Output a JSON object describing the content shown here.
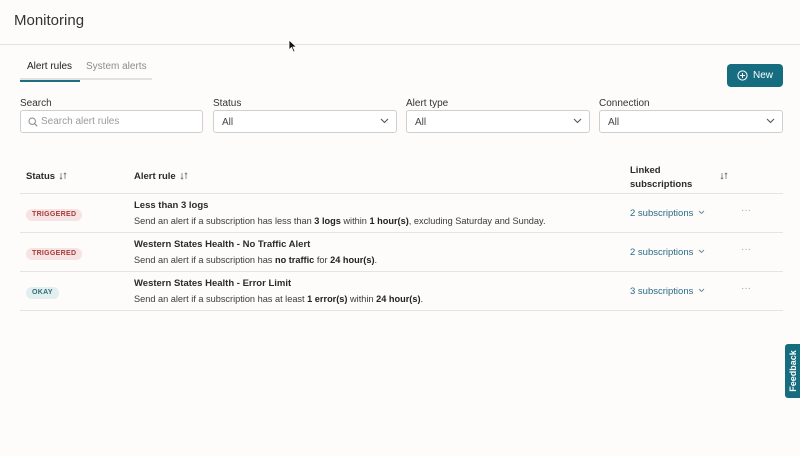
{
  "app": {
    "title": "Monitoring"
  },
  "tabs": [
    {
      "label": "Alert rules",
      "active": true
    },
    {
      "label": "System alerts",
      "active": false
    }
  ],
  "new_button": {
    "label": "New",
    "icon": "plus-circle-icon"
  },
  "filters": {
    "search": {
      "label": "Search",
      "placeholder": "Search alert rules",
      "value": ""
    },
    "status": {
      "label": "Status",
      "value": "All"
    },
    "alert_type": {
      "label": "Alert type",
      "value": "All"
    },
    "connection": {
      "label": "Connection",
      "value": "All"
    }
  },
  "table": {
    "columns": {
      "status": "Status",
      "alert_rule": "Alert rule",
      "linked_line1": "Linked",
      "linked_line2": "subscriptions"
    },
    "rows": [
      {
        "status": "TRIGGERED",
        "name": "Less than 3 logs",
        "desc_parts": [
          "Send an alert if a subscription has less than ",
          "3 logs",
          " within ",
          "1 hour(s)",
          ", excluding Saturday and Sunday."
        ],
        "linked": "2 subscriptions",
        "more": "···"
      },
      {
        "status": "TRIGGERED",
        "name": "Western States Health - No Traffic Alert",
        "desc_parts": [
          "Send an alert if a subscription has ",
          "no traffic",
          " for ",
          "24 hour(s)",
          "."
        ],
        "linked": "2 subscriptions",
        "more": "···"
      },
      {
        "status": "OKAY",
        "name": "Western States Health - Error Limit",
        "desc_parts": [
          "Send an alert if a subscription has at least ",
          "1 error(s)",
          " within ",
          "24 hour(s)",
          "."
        ],
        "linked": "3 subscriptions",
        "more": "···"
      }
    ]
  },
  "feedback": {
    "label": "Feedback"
  },
  "colors": {
    "accent": "#176d80",
    "triggered_bg": "#f6e3e3",
    "triggered_fg": "#a83a3a",
    "okay_bg": "#e1eff0",
    "okay_fg": "#2f6e73",
    "link": "#2a6c86"
  }
}
